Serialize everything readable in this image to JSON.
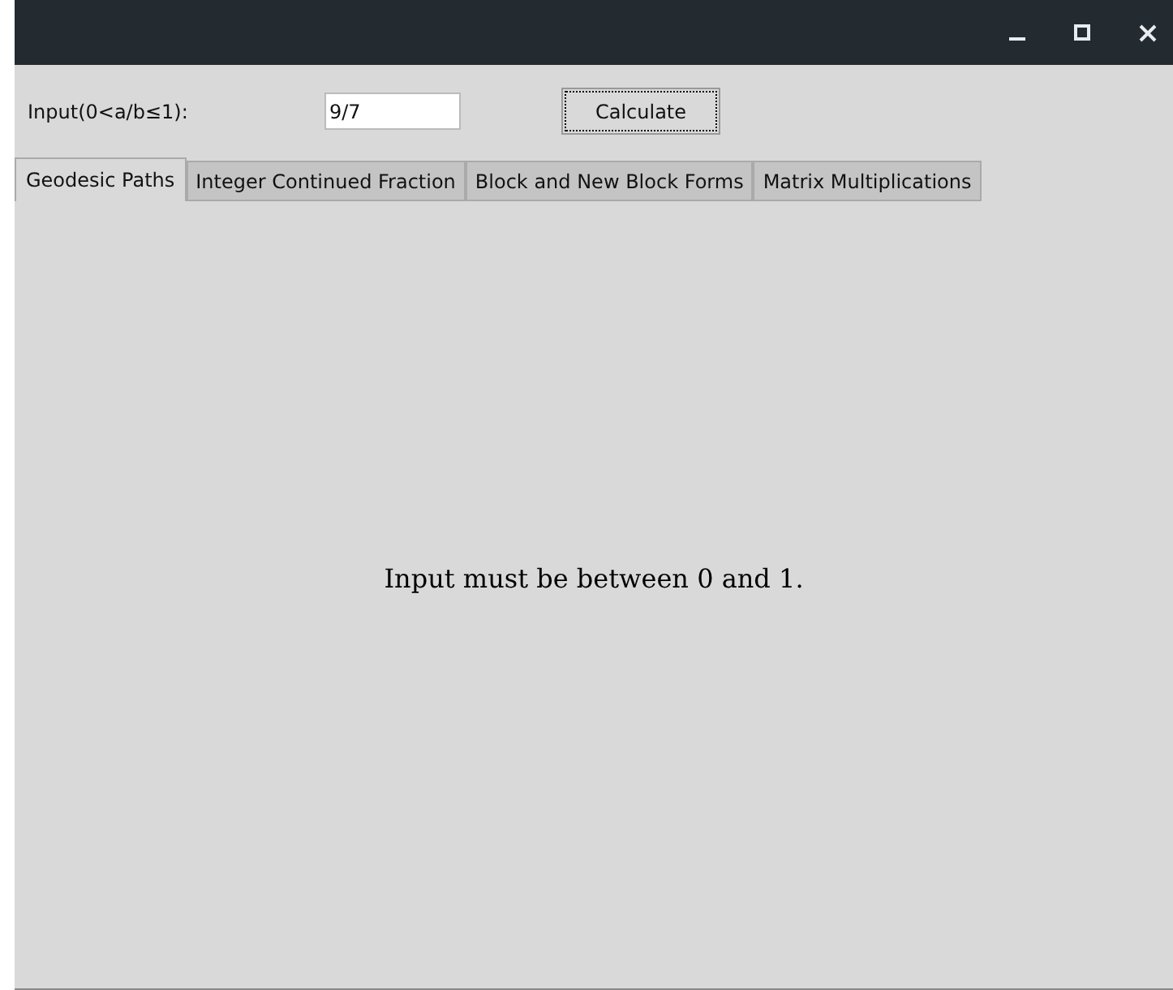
{
  "window": {
    "controls": [
      {
        "kind": "minimize"
      },
      {
        "kind": "maximize"
      },
      {
        "kind": "close"
      }
    ]
  },
  "input": {
    "label": "Input(0<a/b≤1):",
    "value": "9/7"
  },
  "calculate_button": "Calculate",
  "tabs": [
    {
      "label": "Geodesic Paths",
      "selected": true
    },
    {
      "label": "Integer Continued Fraction",
      "selected": false
    },
    {
      "label": "Block and New Block Forms",
      "selected": false
    },
    {
      "label": "Matrix Multiplications",
      "selected": false
    }
  ],
  "message": "Input must be between 0 and 1."
}
